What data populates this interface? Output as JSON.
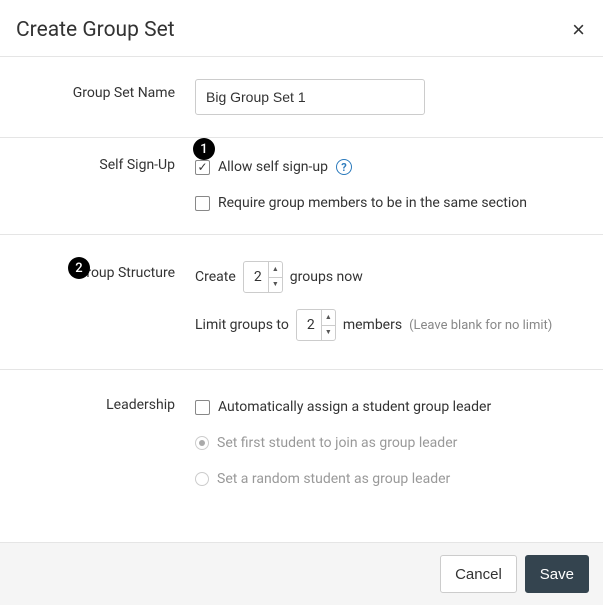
{
  "header": {
    "title": "Create Group Set"
  },
  "badges": {
    "n1": "1",
    "n2": "2"
  },
  "groupSetName": {
    "label": "Group Set Name",
    "value": "Big Group Set 1"
  },
  "selfSignUp": {
    "label": "Self Sign-Up",
    "allow": {
      "label": "Allow self sign-up",
      "checked": true
    },
    "sameSection": {
      "label": "Require group members to be in the same section",
      "checked": false
    },
    "helpGlyph": "?"
  },
  "groupStructure": {
    "label": "Group Structure",
    "createPrefix": "Create",
    "createCount": "2",
    "createSuffix": "groups now",
    "limitPrefix": "Limit groups to",
    "limitCount": "2",
    "limitSuffix": "members",
    "limitHint": "(Leave blank for no limit)"
  },
  "leadership": {
    "label": "Leadership",
    "auto": {
      "label": "Automatically assign a student group leader",
      "checked": false
    },
    "first": {
      "label": "Set first student to join as group leader"
    },
    "random": {
      "label": "Set a random student as group leader"
    }
  },
  "footer": {
    "cancel": "Cancel",
    "save": "Save"
  }
}
